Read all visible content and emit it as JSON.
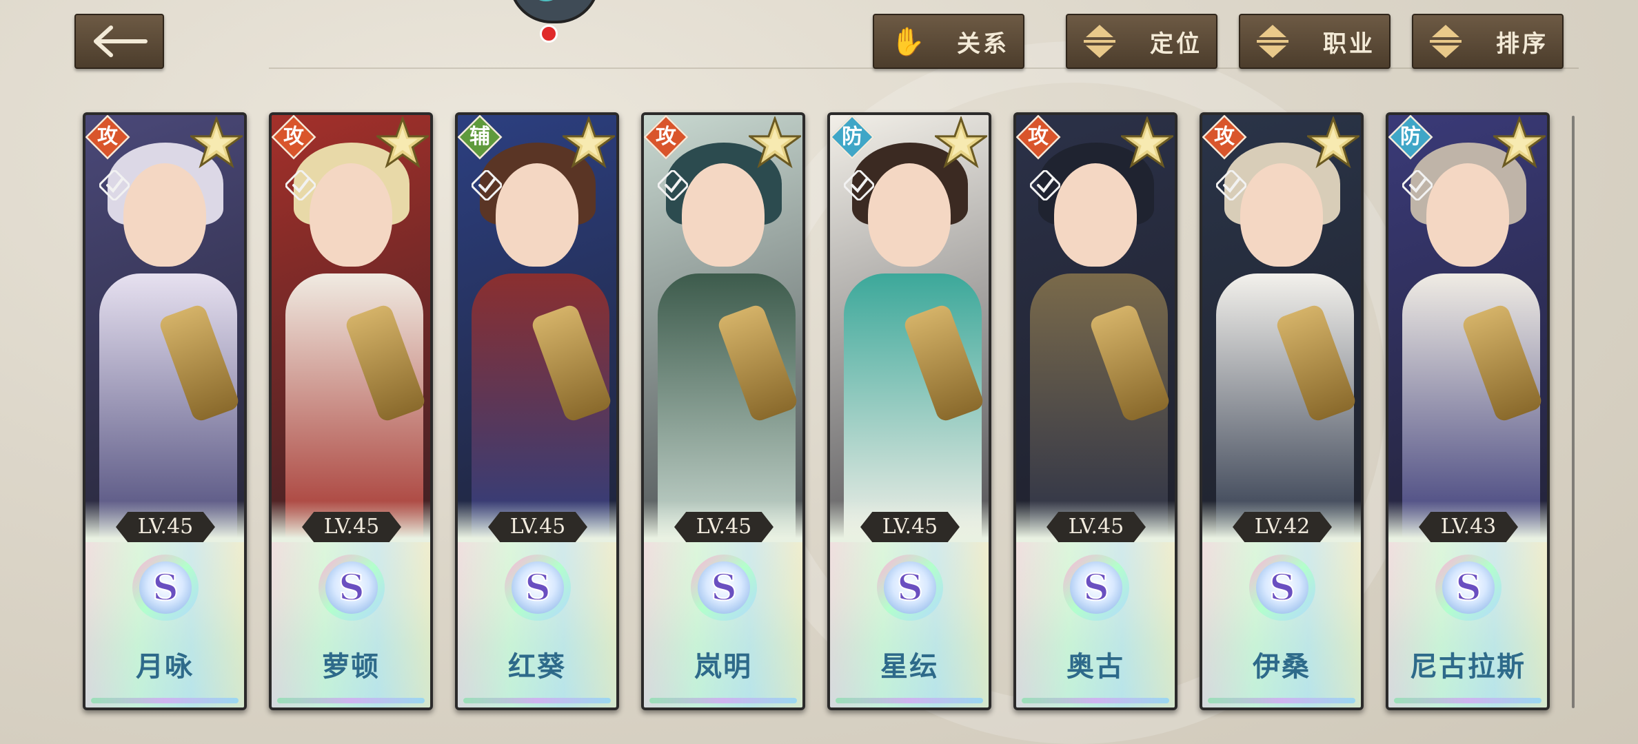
{
  "toolbar": {
    "relation_label": "关系",
    "position_label": "定位",
    "class_label": "职业",
    "sort_label": "排序"
  },
  "colors": {
    "attack": "#d9552b",
    "support": "#5f9a3c",
    "defense": "#3fa6c7",
    "name_text": "#2e6a8a",
    "button_bg": "#5b4a37"
  },
  "heroes": [
    {
      "role": "攻",
      "role_type": "attack",
      "level": "LV.45",
      "rank": "S",
      "name": "月咏",
      "palette": [
        "#dcd8e6",
        "#4a4878",
        "#e7e1f0"
      ]
    },
    {
      "role": "攻",
      "role_type": "attack",
      "level": "LV.45",
      "rank": "S",
      "name": "萝顿",
      "palette": [
        "#e8d9a8",
        "#a3302a",
        "#f0ebe2"
      ]
    },
    {
      "role": "辅",
      "role_type": "support",
      "level": "LV.45",
      "rank": "S",
      "name": "红葵",
      "palette": [
        "#5a3525",
        "#2c3f80",
        "#8b2f2f"
      ]
    },
    {
      "role": "攻",
      "role_type": "attack",
      "level": "LV.45",
      "rank": "S",
      "name": "岚明",
      "palette": [
        "#2c4b4f",
        "#c8d8d0",
        "#3d5b4c"
      ]
    },
    {
      "role": "防",
      "role_type": "defense",
      "level": "LV.45",
      "rank": "S",
      "name": "星纭",
      "palette": [
        "#3b2a22",
        "#f2efe8",
        "#3ca89a"
      ]
    },
    {
      "role": "攻",
      "role_type": "attack",
      "level": "LV.45",
      "rank": "S",
      "name": "奥古",
      "palette": [
        "#1f2330",
        "#2b3148",
        "#7a6a4a"
      ]
    },
    {
      "role": "攻",
      "role_type": "attack",
      "level": "LV.42",
      "rank": "S",
      "name": "伊桑",
      "palette": [
        "#d8cdb8",
        "#2a3448",
        "#f3f1ec"
      ]
    },
    {
      "role": "防",
      "role_type": "defense",
      "level": "LV.43",
      "rank": "S",
      "name": "尼古拉斯",
      "palette": [
        "#bfb4a8",
        "#3a3a78",
        "#f0ece4"
      ]
    }
  ]
}
